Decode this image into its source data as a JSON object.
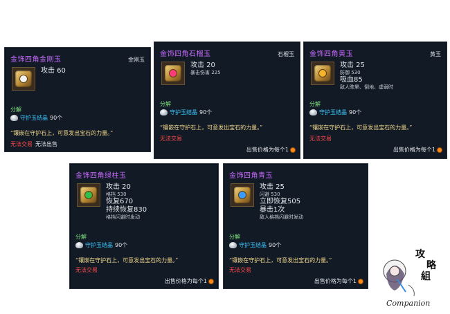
{
  "cards": [
    {
      "title": "金饰四角金刚玉",
      "type": "金刚玉",
      "gem_color": "#f4f4f4",
      "stats": [
        "攻击 60"
      ],
      "decompose": "分解",
      "material": "守护玉结晶",
      "material_count": "90个",
      "desc": "“镶嵌在守护石上，可意发出宝石的力量。”",
      "notrade": "无法交易",
      "extra": "无法出售",
      "sell": ""
    },
    {
      "title": "金饰四角石榴玉",
      "type": "石榴玉",
      "gem_color": "#ff3b7a",
      "stats": [
        "攻击 20",
        "暴击伤害 225"
      ],
      "decompose": "分解",
      "material": "守护玉结晶",
      "material_count": "90个",
      "desc": "“镶嵌在守护石上，可意发出宝石的力量。”",
      "notrade": "无法交易",
      "extra": "",
      "sell": "出售价格为每个1"
    },
    {
      "title": "金饰四角黄玉",
      "type": "黄玉",
      "gem_color": "#f5b42a",
      "stats": [
        "攻击 25",
        "防御 530",
        "吸血85",
        "敌人眩晕、倒地、虚弱时"
      ],
      "decompose": "分解",
      "material": "守护玉结晶",
      "material_count": "90个",
      "desc": "“镶嵌在守护石上，可意发出宝石的力量。”",
      "notrade": "无法交易",
      "extra": "",
      "sell": "出售价格为每个1"
    },
    {
      "title": "金饰四角绿柱玉",
      "type": "",
      "gem_color": "#2fbf4a",
      "stats": [
        "攻击 20",
        "格挡 530",
        "恢复670",
        "持续恢复830",
        "格挡闪避时发动"
      ],
      "decompose": "分解",
      "material": "守护玉结晶",
      "material_count": "90个",
      "desc": "“镶嵌在守护石上，可意发出宝石的力量。”",
      "notrade": "无法交易",
      "extra": "",
      "sell": "出售价格为每个1"
    },
    {
      "title": "金饰四角青玉",
      "type": "",
      "gem_color": "#3a9cff",
      "stats": [
        "攻击 25",
        "闪避 530",
        "立即恢复505",
        "暴击1次",
        "敌人格挡闪避时发动"
      ],
      "decompose": "分解",
      "material": "守护玉结晶",
      "material_count": "90个",
      "desc": "“镶嵌在守护石上，可意发出宝石的力量。”",
      "notrade": "无法交易",
      "extra": "",
      "sell": "出售价格为每个1"
    }
  ],
  "watermark": {
    "text": "Companion",
    "chars": [
      "攻",
      "略",
      "組"
    ]
  }
}
